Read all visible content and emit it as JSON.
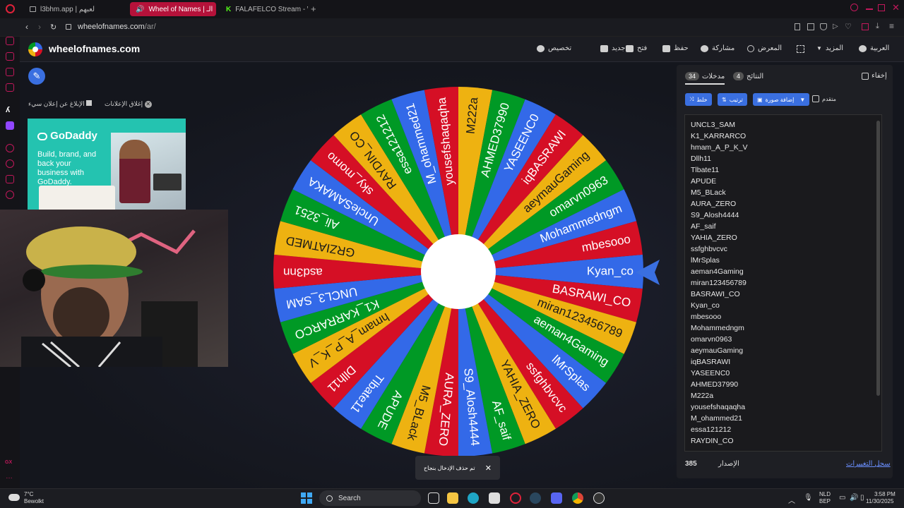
{
  "browser": {
    "tabs": [
      {
        "title": "l3bhm.app | لعبهم",
        "active": false
      },
      {
        "title": "Wheel of Names | الـ",
        "active": true
      },
      {
        "title": "FALAFELCO Stream - Wa",
        "active": false
      }
    ],
    "url_host": "wheelofnames.com",
    "url_path": "/ar/"
  },
  "header": {
    "site_name": "wheelofnames.com",
    "menu": [
      {
        "label": "تخصيص",
        "icon": "palette-icon"
      },
      {
        "label": "جديد",
        "icon": "new-file-icon"
      },
      {
        "label": "فتح",
        "icon": "folder-icon"
      },
      {
        "label": "حفظ",
        "icon": "save-icon"
      },
      {
        "label": "مشاركة",
        "icon": "share-icon"
      },
      {
        "label": "المعرض",
        "icon": "search-icon"
      },
      {
        "label": "المزيد",
        "icon": "chevron-down-icon"
      },
      {
        "label": "العربية",
        "icon": "globe-icon"
      }
    ]
  },
  "ads": {
    "hide_label": "إغلاق الإعلانات",
    "report_label": "الإبلاغ عن إعلان سيء",
    "brand": "GoDaddy",
    "copy": "Build, brand, and back your business with GoDaddy."
  },
  "wheel": {
    "pointer_color": "#3a6fe0",
    "colors": [
      "#3369e8",
      "#d50f25",
      "#eeb211",
      "#009925"
    ],
    "segments": [
      "Kyan_co",
      "BASRAWI_CO",
      "miran123456789",
      "aeman4Gaming",
      "lMrSplas",
      "ssfghbvcvc",
      "YAHIA_ZERO",
      "AF_saif",
      "S9_Alosh4444",
      "AURA_ZERO",
      "M5_BLack",
      "APUDE",
      "Tlbate11",
      "Dllh11",
      "hmam_A_P_K_V",
      "K1_KARRARCO",
      "UNCL3_SAM",
      "asd3nn",
      "GRZIATMED",
      "Ali_3251",
      "UncleSAMAKA",
      "sky_momo",
      "RAYDIN_CO",
      "essa121212",
      "M_ohammed21",
      "yousefshaqaqha",
      "M222a",
      "AHMED37990",
      "YASEENC0",
      "iqBASRAWI",
      "aeymauGaming",
      "omarvn0963",
      "Mohammedngm",
      "mbesooo"
    ]
  },
  "panel": {
    "tab_entries_label": "مدخلات",
    "tab_entries_count": "34",
    "tab_results_label": "النتائج",
    "tab_results_count": "4",
    "hide_label": "إخفاء",
    "shuffle_label": "خلط",
    "sort_label": "ترتيب",
    "add_image_label": "إضافة صورة",
    "advanced_label": "متقدم",
    "entries": [
      "UNCL3_SAM",
      "K1_KARRARCO",
      "hmam_A_P_K_V",
      "Dllh11",
      "Tlbate11",
      "APUDE",
      "M5_BLack",
      "AURA_ZERO",
      "S9_Alosh4444",
      "AF_saif",
      "YAHIA_ZERO",
      "ssfghbvcvc",
      "lMrSplas",
      "aeman4Gaming",
      "miran123456789",
      "BASRAWI_CO",
      "Kyan_co",
      "mbesooo",
      "Mohammedngm",
      "omarvn0963",
      "aeymauGaming",
      "iqBASRAWI",
      "YASEENC0",
      "AHMED37990",
      "M222a",
      "yousefshaqaqha",
      "M_ohammed21",
      "essa121212",
      "RAYDIN_CO"
    ],
    "version_label": "الإصدار",
    "version_number": "385",
    "changelog_label": "سجل التغييرات"
  },
  "toast": {
    "message": "تم حذف الإدخال بنجاح"
  },
  "taskbar": {
    "weather_temp": "7°C",
    "weather_desc": "Bewolkt",
    "search_placeholder": "Search",
    "lang_top": "NLD",
    "lang_bottom": "BEP",
    "time": "3:58 PM",
    "date": "11/30/2025"
  }
}
